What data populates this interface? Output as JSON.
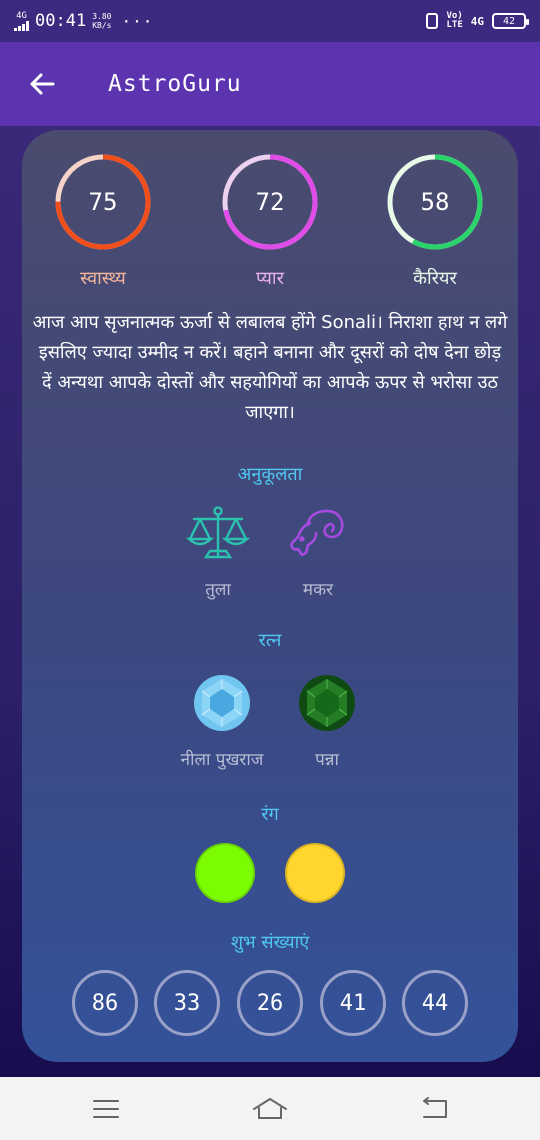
{
  "status_bar": {
    "network": "4G",
    "time": "00:41",
    "speed_value": "3.80",
    "speed_unit": "KB/s",
    "dots": "···",
    "volte_top": "Vo)",
    "volte_bottom": "LTE",
    "network_right": "4G",
    "battery": "42"
  },
  "app_bar": {
    "title": "AstroGuru"
  },
  "meters": [
    {
      "value": "75",
      "label": "स्वास्थ्य",
      "percent": 75,
      "color": "#f04e1a",
      "label_color": "#f2b39a",
      "track": "#f5d3c8"
    },
    {
      "value": "72",
      "label": "प्यार",
      "percent": 72,
      "color": "#e04ce8",
      "label_color": "#e8b0ee",
      "track": "#ecd2f0"
    },
    {
      "value": "58",
      "label": "कैरियर",
      "percent": 58,
      "color": "#2ad46a",
      "label_color": "#e6f7ea",
      "track": "#e8fae8"
    }
  ],
  "description": "आज आप सृजनात्मक ऊर्जा से लबालब होंगे Sonali। निराशा हाथ न लगे इसलिए ज्यादा उम्मीद न करें। बहाने बनाना और दूसरों को दोष देना छोड़ दें अन्यथा आपके दोस्तों और सहयोगियों का आपके ऊपर से भरोसा उठ जाएगा।",
  "compatibility": {
    "title": "अनुकूलता",
    "items": [
      {
        "label": "तुला",
        "icon": "libra-scales-icon"
      },
      {
        "label": "मकर",
        "icon": "capricorn-goat-icon"
      }
    ]
  },
  "gems": {
    "title": "रत्न",
    "items": [
      {
        "label": "नीला पुखराज",
        "icon": "blue-topaz-gem-icon",
        "color": "#6fc8f2"
      },
      {
        "label": "पन्ना",
        "icon": "emerald-gem-icon",
        "color": "#1f7a1f"
      }
    ]
  },
  "colors": {
    "title": "रंग",
    "swatches": [
      "#7cfc00",
      "#ffd52e"
    ]
  },
  "lucky_numbers": {
    "title": "शुभ संख्याएं",
    "values": [
      "86",
      "33",
      "26",
      "41",
      "44"
    ]
  }
}
